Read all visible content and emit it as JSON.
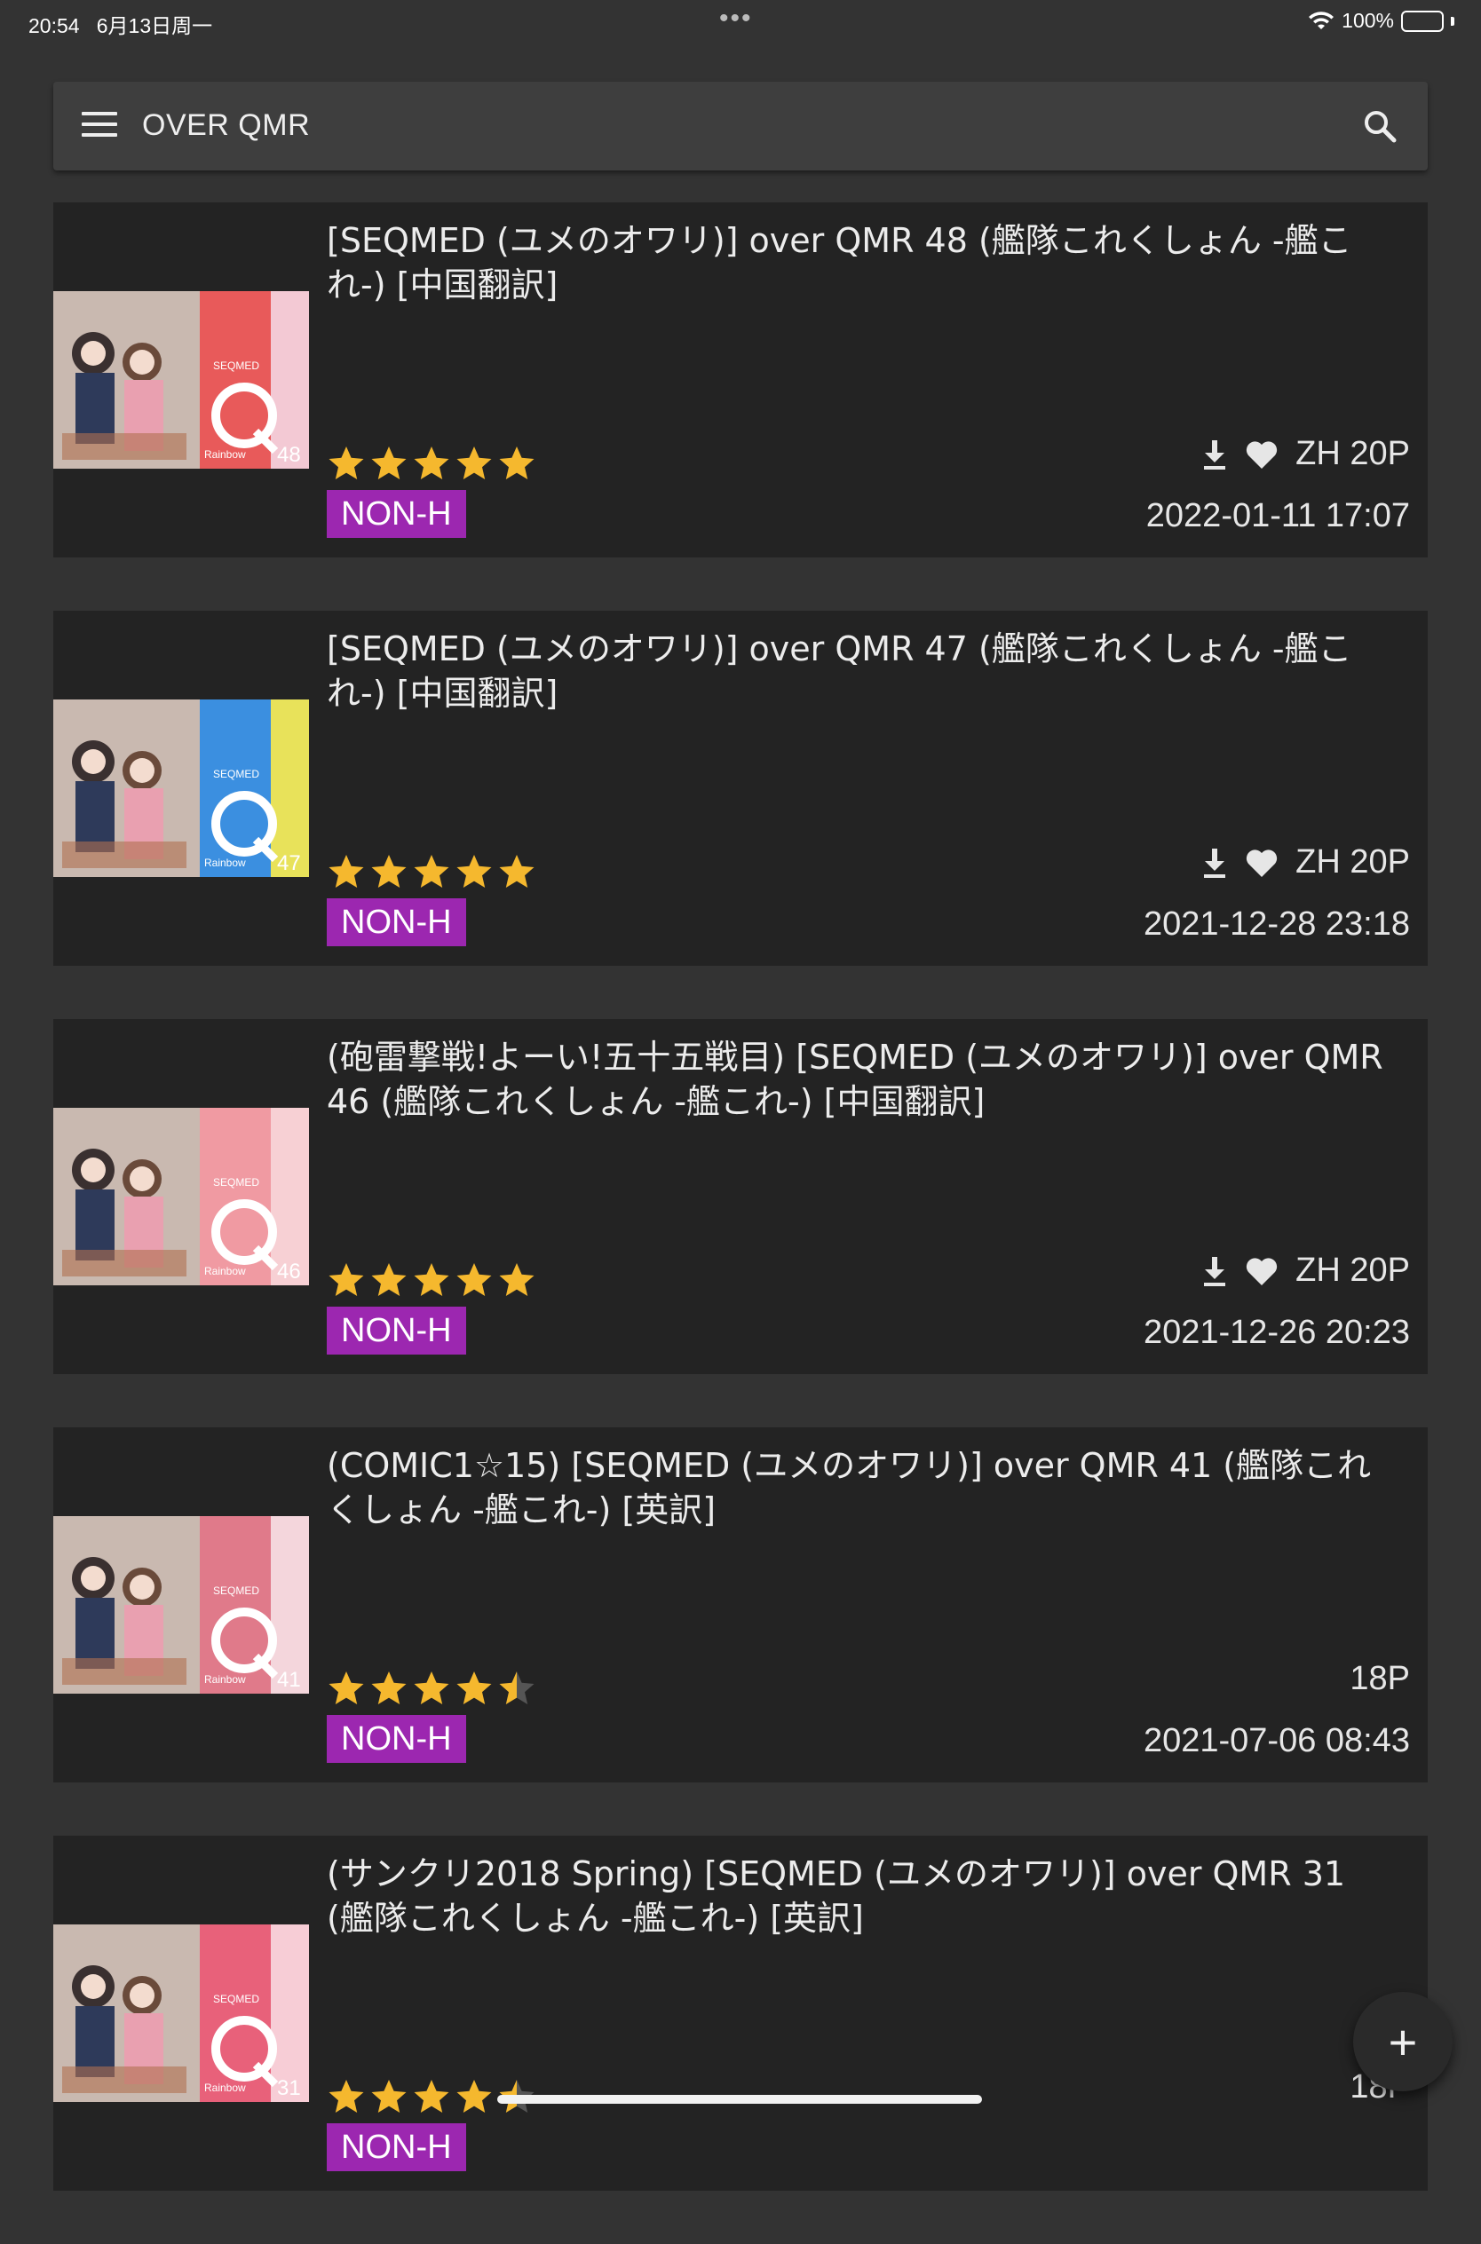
{
  "status": {
    "time": "20:54",
    "date": "6月13日周一",
    "battery_text": "100%"
  },
  "search": {
    "query": "OVER QMR"
  },
  "colors": {
    "star": "#f5b82e",
    "star_empty": "#555555",
    "badge": "#9c27b0"
  },
  "items": [
    {
      "title": "[SEQMED (ユメのオワリ)] over QMR 48 (艦隊これくしょん -艦これ-) [中国翻訳]",
      "rating": 5,
      "category": "NON-H",
      "meta": "ZH 20P",
      "show_icons": true,
      "date": "2022-01-11 17:07",
      "cover_number": "48",
      "cover_color": "#e85a5a",
      "cover_pattern": "#f3c9d4"
    },
    {
      "title": "[SEQMED (ユメのオワリ)] over QMR 47 (艦隊これくしょん -艦これ-) [中国翻訳]",
      "rating": 5,
      "category": "NON-H",
      "meta": "ZH 20P",
      "show_icons": true,
      "date": "2021-12-28 23:18",
      "cover_number": "47",
      "cover_color": "#3b8fe0",
      "cover_pattern": "#e8e25a"
    },
    {
      "title": "(砲雷撃戦!よーい!五十五戦目) [SEQMED (ユメのオワリ)] over QMR 46 (艦隊これくしょん -艦これ-) [中国翻訳]",
      "rating": 5,
      "category": "NON-H",
      "meta": "ZH 20P",
      "show_icons": true,
      "date": "2021-12-26 20:23",
      "cover_number": "46",
      "cover_color": "#f09aa2",
      "cover_pattern": "#f7d0d4"
    },
    {
      "title": "(COMIC1☆15) [SEQMED (ユメのオワリ)] over QMR 41 (艦隊これくしょん -艦これ-) [英訳]",
      "rating": 4.5,
      "category": "NON-H",
      "meta": "18P",
      "show_icons": false,
      "date": "2021-07-06 08:43",
      "cover_number": "41",
      "cover_color": "#e07a8a",
      "cover_pattern": "#f4d6dc"
    },
    {
      "title": "(サンクリ2018 Spring) [SEQMED (ユメのオワリ)] over QMR 31 (艦隊これくしょん -艦これ-) [英訳]",
      "rating": 4.5,
      "category": "NON-H",
      "meta": "18P",
      "show_icons": false,
      "date": "",
      "cover_number": "31",
      "cover_color": "#e8617a",
      "cover_pattern": "#f7cdd6"
    }
  ],
  "fab": {
    "label": "+"
  }
}
